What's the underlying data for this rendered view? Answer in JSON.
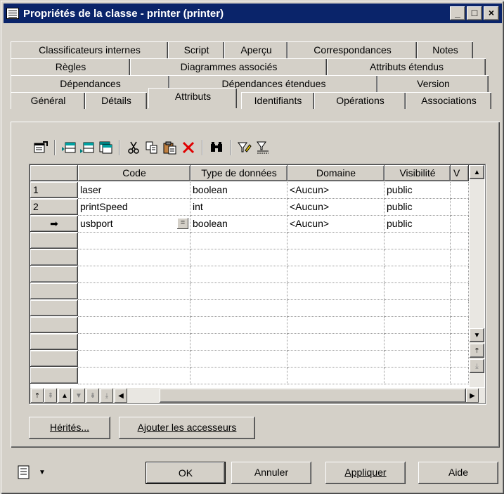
{
  "window": {
    "title": "Propriétés de la classe - printer (printer)",
    "controls": [
      "_",
      "□",
      "×"
    ]
  },
  "tabs": {
    "row1": [
      "Classificateurs internes",
      "Script",
      "Aperçu",
      "Correspondances",
      "Notes"
    ],
    "row2": [
      "Règles",
      "Diagrammes associés",
      "Attributs étendus"
    ],
    "row3": [
      "Dépendances",
      "Dépendances étendues",
      "Version"
    ],
    "row4": [
      "Général",
      "Détails",
      "Attributs",
      "Identifiants",
      "Opérations",
      "Associations"
    ],
    "active": "Attributs"
  },
  "toolbar": {
    "icons": [
      "properties-icon",
      "insert-row-icon",
      "add-row-icon",
      "add-objects-icon",
      "cut-icon",
      "copy-icon",
      "paste-icon",
      "delete-icon",
      "find-icon",
      "filter-icon",
      "clear-filter-icon"
    ]
  },
  "grid": {
    "columns": [
      "Code",
      "Type de données",
      "Domaine",
      "Visibilité",
      "V"
    ],
    "rows": [
      {
        "header": "1",
        "code": "laser",
        "type": "boolean",
        "domain": "<Aucun>",
        "visibility": "public"
      },
      {
        "header": "2",
        "code": "printSpeed",
        "type": "int",
        "domain": "<Aucun>",
        "visibility": "public"
      },
      {
        "header": "➡",
        "code": "usbport",
        "type": "boolean",
        "domain": "<Aucun>",
        "visibility": "public"
      }
    ],
    "empty_rows": 9
  },
  "buttons": {
    "inherited": "Hérités...",
    "add_accessors": "Ajouter les accesseurs",
    "ok": "OK",
    "cancel": "Annuler",
    "apply": "Appliquer",
    "help": "Aide"
  }
}
